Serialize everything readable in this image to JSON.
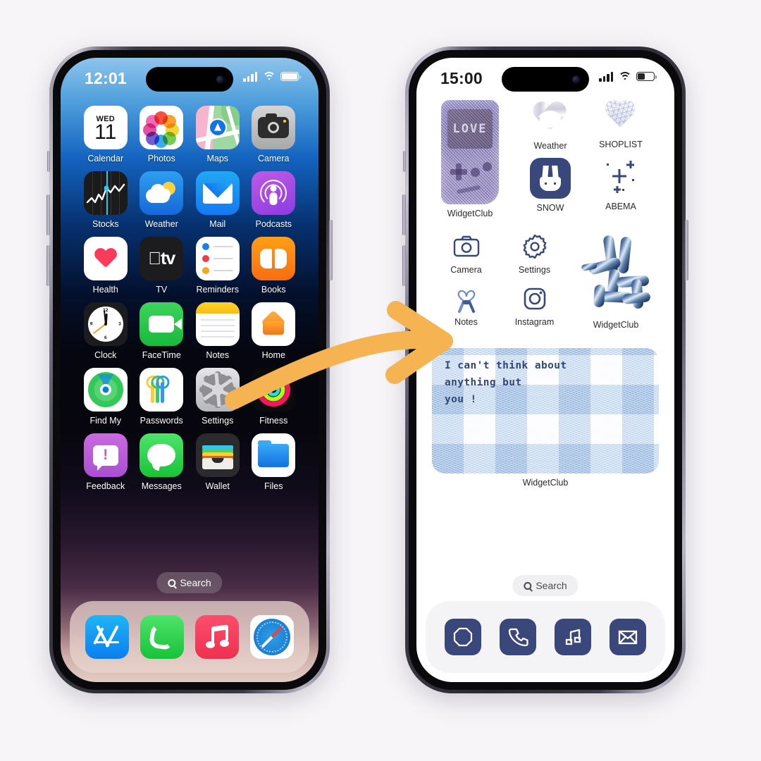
{
  "page": {
    "background_color": "#f7f5f8",
    "accent_arrow_color": "#f5b352",
    "description": "Before and after iPhone home screen customization comparison"
  },
  "left_phone": {
    "name": "default-home-screen",
    "status_bar": {
      "time": "12:01",
      "signal_icon": "cellular-bars-icon",
      "wifi_icon": "wifi-icon",
      "battery_icon": "battery-icon",
      "battery_level": 95
    },
    "search_label": "Search",
    "search_icon": "search-icon",
    "rows": [
      [
        {
          "label": "Calendar",
          "icon": "calendar-icon",
          "day": "WED",
          "date": "11"
        },
        {
          "label": "Photos",
          "icon": "photos-icon"
        },
        {
          "label": "Maps",
          "icon": "maps-icon"
        },
        {
          "label": "Camera",
          "icon": "camera-icon"
        }
      ],
      [
        {
          "label": "Stocks",
          "icon": "stocks-icon"
        },
        {
          "label": "Weather",
          "icon": "weather-icon"
        },
        {
          "label": "Mail",
          "icon": "mail-icon"
        },
        {
          "label": "Podcasts",
          "icon": "podcasts-icon"
        }
      ],
      [
        {
          "label": "Health",
          "icon": "health-icon"
        },
        {
          "label": "TV",
          "icon": "tv-icon"
        },
        {
          "label": "Reminders",
          "icon": "reminders-icon"
        },
        {
          "label": "Books",
          "icon": "books-icon"
        }
      ],
      [
        {
          "label": "Clock",
          "icon": "clock-icon"
        },
        {
          "label": "FaceTime",
          "icon": "facetime-icon"
        },
        {
          "label": "Notes",
          "icon": "notes-icon"
        },
        {
          "label": "Home",
          "icon": "home-icon"
        }
      ],
      [
        {
          "label": "Find My",
          "icon": "find-my-icon"
        },
        {
          "label": "Passwords",
          "icon": "passwords-icon"
        },
        {
          "label": "Settings",
          "icon": "settings-icon"
        },
        {
          "label": "Fitness",
          "icon": "fitness-icon"
        }
      ],
      [
        {
          "label": "Feedback",
          "icon": "feedback-icon"
        },
        {
          "label": "Messages",
          "icon": "messages-icon"
        },
        {
          "label": "Wallet",
          "icon": "wallet-icon"
        },
        {
          "label": "Files",
          "icon": "files-icon"
        }
      ]
    ],
    "dock": [
      {
        "label": "App Store",
        "icon": "app-store-icon"
      },
      {
        "label": "Phone",
        "icon": "phone-icon"
      },
      {
        "label": "Music",
        "icon": "music-icon"
      },
      {
        "label": "Safari",
        "icon": "safari-icon"
      }
    ]
  },
  "right_phone": {
    "name": "customized-home-screen",
    "status_bar": {
      "time": "15:00",
      "signal_icon": "cellular-bars-icon",
      "wifi_icon": "wifi-icon",
      "battery_icon": "battery-icon",
      "battery_level": 42
    },
    "search_label": "Search",
    "search_icon": "search-icon",
    "theme_color": "#39477a",
    "gameboy_widget": {
      "label": "WidgetClub",
      "screen_text": "LOVE",
      "icon": "rhinestone-gameboy-widget"
    },
    "top_icons": [
      {
        "label": "Weather",
        "icon": "chrome-heart-icon"
      },
      {
        "label": "SHOPLIST",
        "icon": "crystal-heart-icon"
      },
      {
        "label": "SNOW",
        "icon": "pixel-bunny-icon"
      },
      {
        "label": "ABEMA",
        "icon": "sparkle-icon"
      }
    ],
    "mid_icons": [
      {
        "label": "Camera",
        "icon": "outline-camera-icon"
      },
      {
        "label": "Settings",
        "icon": "outline-gear-icon"
      },
      {
        "label": "Notes",
        "icon": "ribbon-heart-icon"
      },
      {
        "label": "Instagram",
        "icon": "outline-instagram-icon"
      }
    ],
    "balloon_widget": {
      "label": "WidgetClub",
      "icon": "balloon-rabbit-widget"
    },
    "text_widget": {
      "label": "WidgetClub",
      "lines": [
        "I can't think about",
        "anything but",
        "you !"
      ],
      "icon": "fluffy-checkered-text-widget"
    },
    "dock": [
      {
        "label": "Safari",
        "icon": "outline-compass-icon"
      },
      {
        "label": "Phone",
        "icon": "outline-phone-icon"
      },
      {
        "label": "Music",
        "icon": "outline-music-icon"
      },
      {
        "label": "Mail",
        "icon": "outline-mail-icon"
      }
    ]
  }
}
